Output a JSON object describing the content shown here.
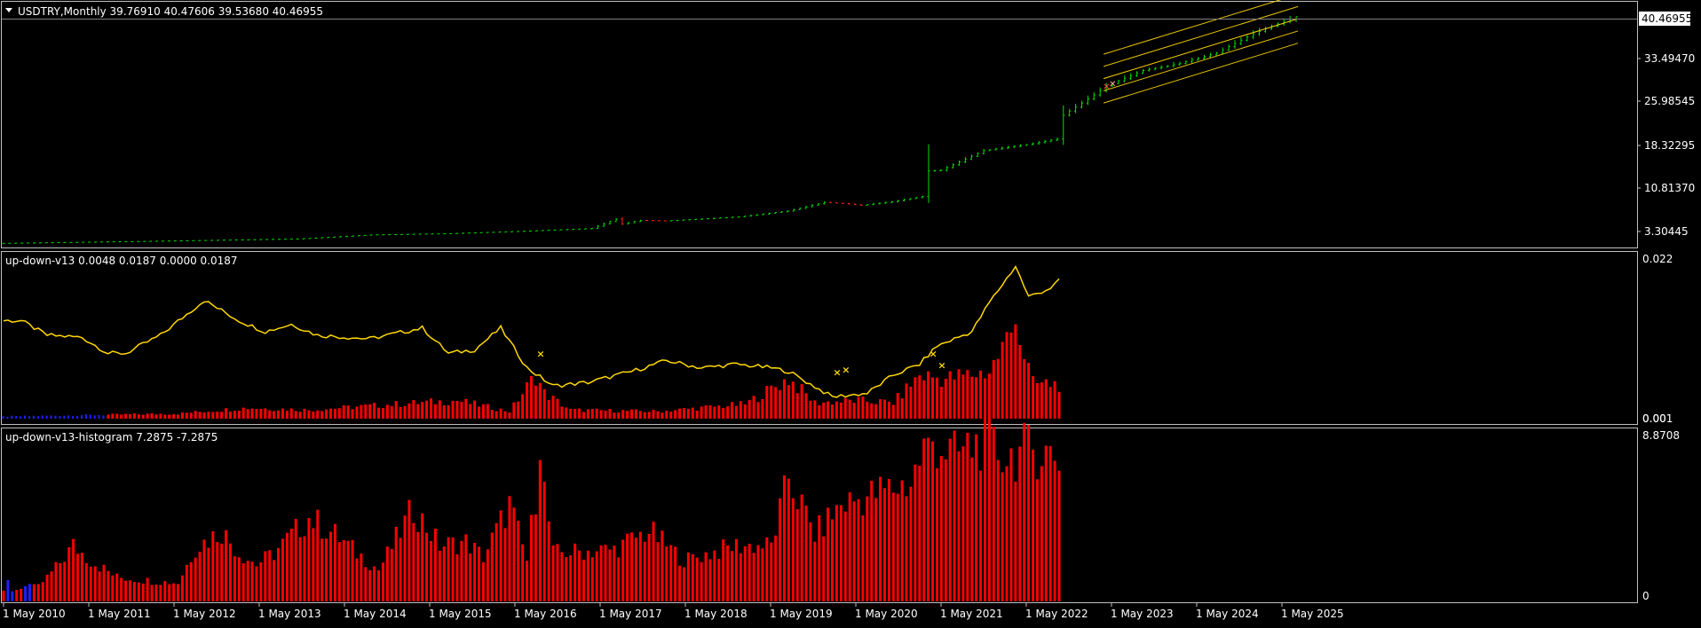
{
  "main": {
    "caption": "USDTRY,Monthly  39.76910 40.47606 39.53680 40.46955",
    "price_label": "40.46955",
    "axis_ticks": [
      "33.49470",
      "25.98545",
      "18.32295",
      "10.81370",
      "3.30445"
    ]
  },
  "ind1": {
    "caption": "up-down-v13 0.0048 0.0187 0.0000 0.0187",
    "axis_top": "0.022",
    "axis_bottom": "0.001",
    "axis_bottom_overlap": "0.00"
  },
  "ind2": {
    "caption": "up-down-v13-histogram 7.2875 -7.2875",
    "axis_top": "8.8708",
    "axis_bottom": "0"
  },
  "time_axis": [
    "1 May 2010",
    "1 May 2011",
    "1 May 2012",
    "1 May 2013",
    "1 May 2014",
    "1 May 2015",
    "1 May 2016",
    "1 May 2017",
    "1 May 2018",
    "1 May 2019",
    "1 May 2020",
    "1 May 2021",
    "1 May 2022",
    "1 May 2023",
    "1 May 2024",
    "1 May 2025"
  ],
  "colors": {
    "background": "#000000",
    "frame": "#c0c0c0",
    "bull": "#00e000",
    "bear": "#ff2020",
    "indicator_line": "#ffd700",
    "histogram": "#ff0000",
    "histogram_neg": "#2020ff",
    "channel": "#ffd700",
    "marker": "#ffd700"
  },
  "chart_data": [
    {
      "type": "candlestick",
      "symbol": "USDTRY",
      "timeframe": "Monthly",
      "last": {
        "open": 39.7691,
        "high": 40.47606,
        "low": 39.5368,
        "close": 40.46955
      },
      "ylim": [
        1.5,
        41.5
      ],
      "x_range": [
        "2010-01",
        "2025-08"
      ],
      "monthly_close_anchors": [
        {
          "month": 0,
          "close": 1.45
        },
        {
          "month": 24,
          "close": 1.8
        },
        {
          "month": 48,
          "close": 2.2
        },
        {
          "month": 60,
          "close": 2.9
        },
        {
          "month": 72,
          "close": 3.1
        },
        {
          "month": 84,
          "close": 3.5
        },
        {
          "month": 96,
          "close": 4.0
        },
        {
          "month": 100,
          "close": 5.6
        },
        {
          "month": 101,
          "close": 4.8
        },
        {
          "month": 104,
          "close": 5.4
        },
        {
          "month": 108,
          "close": 5.3
        },
        {
          "month": 120,
          "close": 6.0
        },
        {
          "month": 128,
          "close": 7.0
        },
        {
          "month": 134,
          "close": 8.5
        },
        {
          "month": 137,
          "close": 8.3
        },
        {
          "month": 140,
          "close": 8.0
        },
        {
          "month": 145,
          "close": 8.6
        },
        {
          "month": 150,
          "close": 9.5
        },
        {
          "month": 151,
          "close": 13.9
        },
        {
          "month": 153,
          "close": 14.0
        },
        {
          "month": 160,
          "close": 17.4
        },
        {
          "month": 168,
          "close": 18.6
        },
        {
          "month": 172,
          "close": 19.4
        },
        {
          "month": 173,
          "close": 23.5
        },
        {
          "month": 178,
          "close": 27.0
        },
        {
          "month": 180,
          "close": 28.5
        },
        {
          "month": 186,
          "close": 31.2
        },
        {
          "month": 192,
          "close": 32.4
        },
        {
          "month": 198,
          "close": 34.2
        },
        {
          "month": 204,
          "close": 37.5
        },
        {
          "month": 207,
          "close": 38.8
        },
        {
          "month": 211,
          "close": 40.47
        }
      ],
      "regression_channel": {
        "from_month": 180,
        "to_month": 211,
        "center_start": 29.8,
        "center_end": 40.1,
        "band_offsets": [
          -4.2,
          -2.1,
          2.1,
          4.2
        ]
      },
      "markers": [
        {
          "month": 180,
          "type": "buy"
        },
        {
          "month": 181,
          "type": "sell"
        }
      ]
    },
    {
      "type": "line",
      "name": "up-down-v13",
      "ylim": [
        0,
        0.022
      ],
      "last_values": [
        0.0048,
        0.0187,
        0.0,
        0.0187
      ],
      "line_anchors": [
        {
          "month": 0,
          "value": 0.0135
        },
        {
          "month": 4,
          "value": 0.0135
        },
        {
          "month": 10,
          "value": 0.0115
        },
        {
          "month": 18,
          "value": 0.0112
        },
        {
          "month": 24,
          "value": 0.009
        },
        {
          "month": 28,
          "value": 0.009
        },
        {
          "month": 36,
          "value": 0.0115
        },
        {
          "month": 46,
          "value": 0.0163
        },
        {
          "month": 54,
          "value": 0.0135
        },
        {
          "month": 60,
          "value": 0.012
        },
        {
          "month": 66,
          "value": 0.013
        },
        {
          "month": 72,
          "value": 0.0115
        },
        {
          "month": 84,
          "value": 0.011
        },
        {
          "month": 96,
          "value": 0.0125
        },
        {
          "month": 102,
          "value": 0.009
        },
        {
          "month": 108,
          "value": 0.0095
        },
        {
          "month": 114,
          "value": 0.0125
        },
        {
          "month": 120,
          "value": 0.007
        },
        {
          "month": 126,
          "value": 0.0045
        },
        {
          "month": 134,
          "value": 0.005
        },
        {
          "month": 144,
          "value": 0.0065
        },
        {
          "month": 152,
          "value": 0.008
        },
        {
          "month": 160,
          "value": 0.007
        },
        {
          "month": 168,
          "value": 0.0075
        },
        {
          "month": 176,
          "value": 0.007
        },
        {
          "month": 180,
          "value": 0.0065
        },
        {
          "month": 190,
          "value": 0.003
        },
        {
          "month": 198,
          "value": 0.0035
        },
        {
          "month": 204,
          "value": 0.006
        },
        {
          "month": 210,
          "value": 0.0075
        },
        {
          "month": 214,
          "value": 0.01
        },
        {
          "month": 222,
          "value": 0.012
        },
        {
          "month": 226,
          "value": 0.016
        },
        {
          "month": 232,
          "value": 0.021
        },
        {
          "month": 235,
          "value": 0.0168
        },
        {
          "month": 240,
          "value": 0.018
        },
        {
          "month": 242,
          "value": 0.019
        }
      ],
      "histogram_anchors": [
        {
          "month": 0,
          "value": 0.0003
        },
        {
          "month": 20,
          "value": 0.0005
        },
        {
          "month": 40,
          "value": 0.0007
        },
        {
          "month": 56,
          "value": 0.0015
        },
        {
          "month": 70,
          "value": 0.0012
        },
        {
          "month": 90,
          "value": 0.002
        },
        {
          "month": 104,
          "value": 0.0025
        },
        {
          "month": 116,
          "value": 0.001
        },
        {
          "month": 122,
          "value": 0.006
        },
        {
          "month": 124,
          "value": 0.0035
        },
        {
          "month": 130,
          "value": 0.0012
        },
        {
          "month": 150,
          "value": 0.001
        },
        {
          "month": 160,
          "value": 0.0015
        },
        {
          "month": 170,
          "value": 0.002
        },
        {
          "month": 180,
          "value": 0.0055
        },
        {
          "month": 186,
          "value": 0.0022
        },
        {
          "month": 196,
          "value": 0.0025
        },
        {
          "month": 204,
          "value": 0.0022
        },
        {
          "month": 210,
          "value": 0.006
        },
        {
          "month": 216,
          "value": 0.0055
        },
        {
          "month": 226,
          "value": 0.0065
        },
        {
          "month": 232,
          "value": 0.013
        },
        {
          "month": 236,
          "value": 0.0048
        },
        {
          "month": 242,
          "value": 0.0048
        }
      ],
      "markers": [
        {
          "month": 123,
          "value": 0.009
        },
        {
          "month": 191,
          "value": 0.0064
        },
        {
          "month": 193,
          "value": 0.0068
        },
        {
          "month": 213,
          "value": 0.009
        },
        {
          "month": 215,
          "value": 0.0074
        }
      ]
    },
    {
      "type": "bar",
      "name": "up-down-v13-histogram",
      "ylim": [
        0,
        8.8708
      ],
      "last_values": [
        7.2875,
        -7.2875
      ],
      "negative_months": [
        1,
        2,
        5,
        6
      ],
      "bar_anchors": [
        {
          "month": 0,
          "value": 0.6
        },
        {
          "month": 8,
          "value": 0.8
        },
        {
          "month": 12,
          "value": 1.8
        },
        {
          "month": 16,
          "value": 3.0
        },
        {
          "month": 20,
          "value": 2.2
        },
        {
          "month": 26,
          "value": 1.3
        },
        {
          "month": 34,
          "value": 1.1
        },
        {
          "month": 40,
          "value": 1.0
        },
        {
          "month": 44,
          "value": 2.9
        },
        {
          "month": 50,
          "value": 3.8
        },
        {
          "month": 54,
          "value": 2.6
        },
        {
          "month": 58,
          "value": 2.0
        },
        {
          "month": 62,
          "value": 2.6
        },
        {
          "month": 70,
          "value": 4.5
        },
        {
          "month": 76,
          "value": 3.6
        },
        {
          "month": 80,
          "value": 2.8
        },
        {
          "month": 86,
          "value": 1.7
        },
        {
          "month": 94,
          "value": 5.0
        },
        {
          "month": 100,
          "value": 3.0
        },
        {
          "month": 106,
          "value": 3.2
        },
        {
          "month": 110,
          "value": 2.4
        },
        {
          "month": 116,
          "value": 5.2
        },
        {
          "month": 120,
          "value": 2.2
        },
        {
          "month": 123,
          "value": 7.6
        },
        {
          "month": 126,
          "value": 2.6
        },
        {
          "month": 140,
          "value": 2.8
        },
        {
          "month": 148,
          "value": 3.8
        },
        {
          "month": 156,
          "value": 2.2
        },
        {
          "month": 168,
          "value": 3.0
        },
        {
          "month": 176,
          "value": 3.0
        },
        {
          "month": 180,
          "value": 6.6
        },
        {
          "month": 186,
          "value": 3.6
        },
        {
          "month": 192,
          "value": 5.2
        },
        {
          "month": 200,
          "value": 5.8
        },
        {
          "month": 208,
          "value": 6.4
        },
        {
          "month": 212,
          "value": 8.8
        },
        {
          "month": 218,
          "value": 7.8
        },
        {
          "month": 224,
          "value": 8.6
        },
        {
          "month": 230,
          "value": 7.8
        },
        {
          "month": 236,
          "value": 8.2
        },
        {
          "month": 242,
          "value": 7.8
        }
      ]
    }
  ]
}
